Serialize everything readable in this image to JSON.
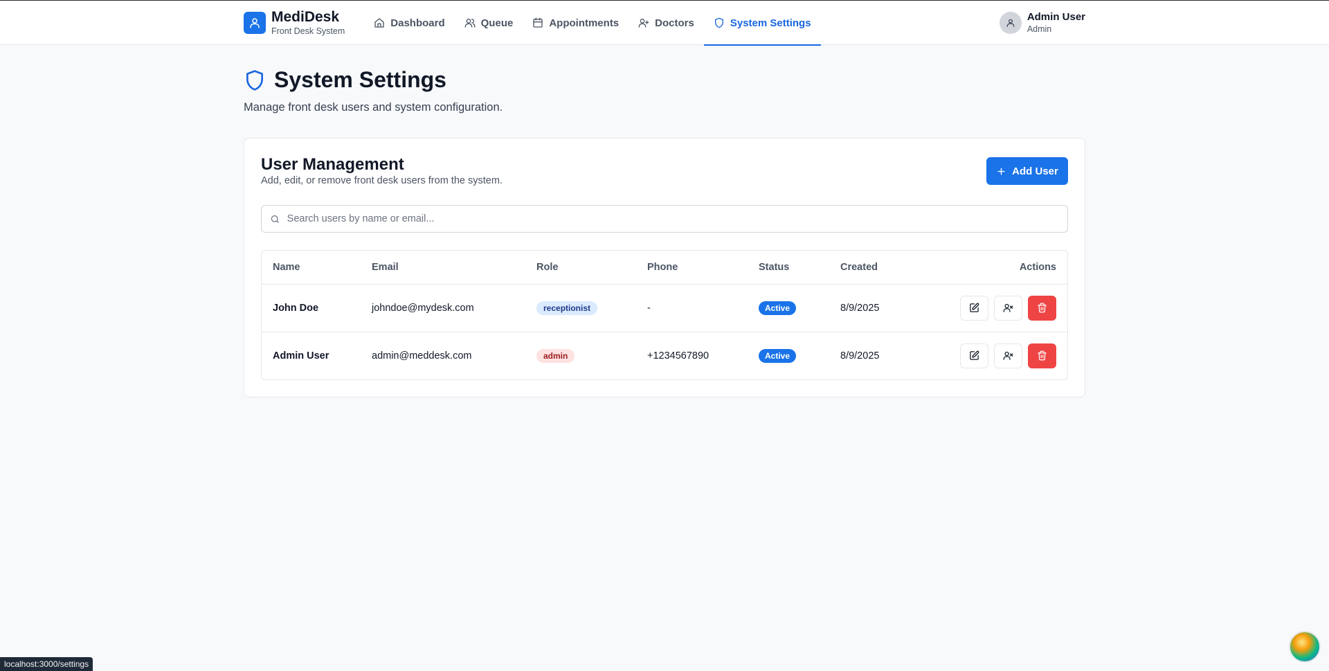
{
  "browser": {
    "status_url": "localhost:3000/settings"
  },
  "brand": {
    "name": "MediDesk",
    "subtitle": "Front Desk System",
    "icon": "user-icon"
  },
  "nav": {
    "items": [
      {
        "label": "Dashboard",
        "icon": "home-icon",
        "active": false
      },
      {
        "label": "Queue",
        "icon": "users-icon",
        "active": false
      },
      {
        "label": "Appointments",
        "icon": "calendar-icon",
        "active": false
      },
      {
        "label": "Doctors",
        "icon": "user-plus-icon",
        "active": false
      },
      {
        "label": "System Settings",
        "icon": "shield-icon",
        "active": true
      }
    ]
  },
  "user": {
    "name": "Admin User",
    "role": "Admin"
  },
  "page": {
    "title": "System Settings",
    "subtitle": "Manage front desk users and system configuration."
  },
  "user_management": {
    "title": "User Management",
    "description": "Add, edit, or remove front desk users from the system.",
    "add_button": "Add User",
    "search_placeholder": "Search users by name or email...",
    "columns": [
      "Name",
      "Email",
      "Role",
      "Phone",
      "Status",
      "Created",
      "Actions"
    ],
    "rows": [
      {
        "name": "John Doe",
        "email": "johndoe@mydesk.com",
        "role": "receptionist",
        "phone": "-",
        "status": "Active",
        "created": "8/9/2025"
      },
      {
        "name": "Admin User",
        "email": "admin@meddesk.com",
        "role": "admin",
        "phone": "+1234567890",
        "status": "Active",
        "created": "8/9/2025"
      }
    ]
  },
  "colors": {
    "primary": "#1a73e8",
    "danger": "#ef4444",
    "receptionist_badge_bg": "#dbeafe",
    "admin_badge_bg": "#fee2e2"
  }
}
